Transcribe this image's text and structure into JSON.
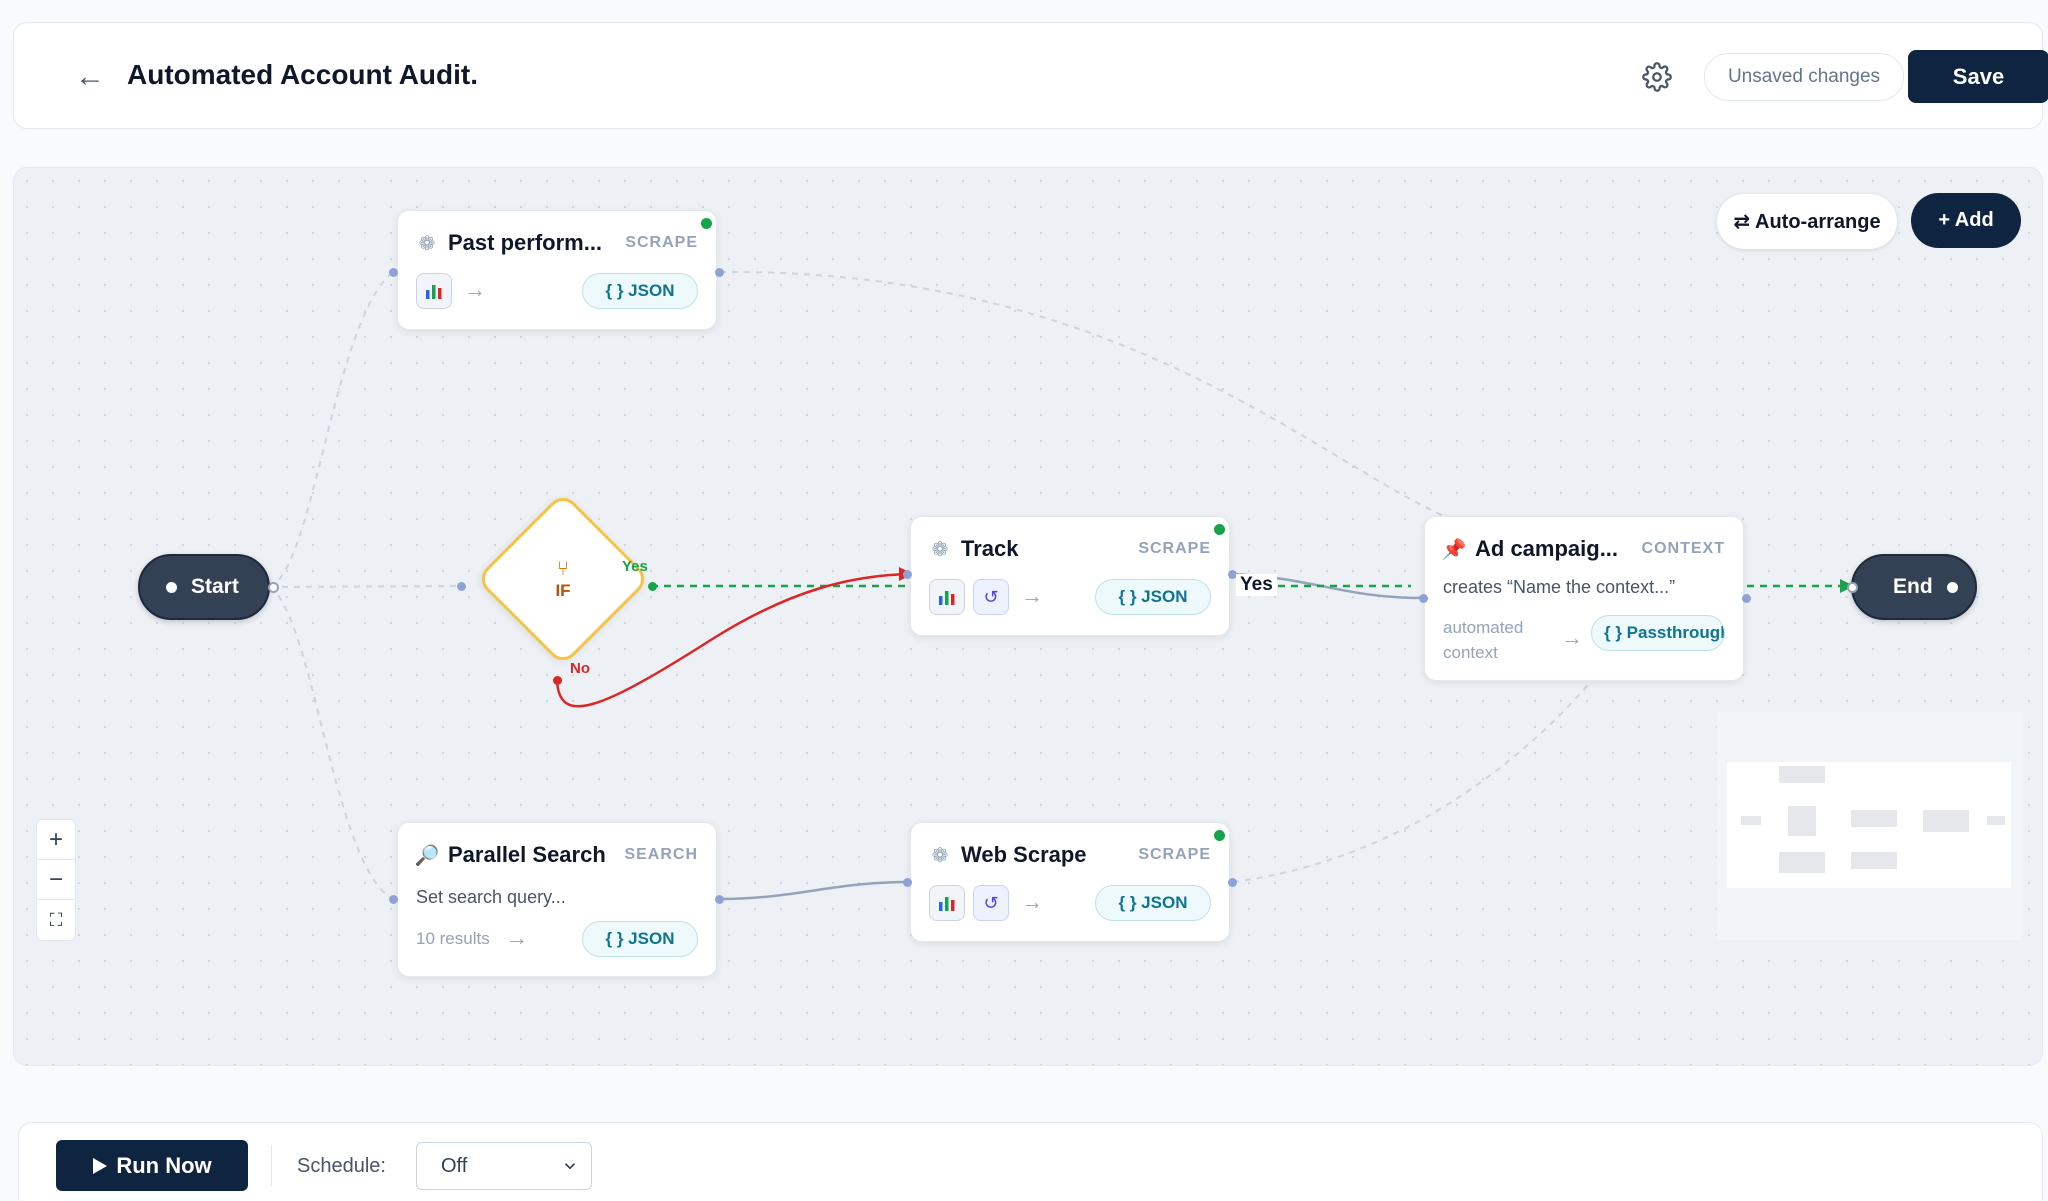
{
  "header": {
    "back_icon": "←",
    "title": "Automated Account Audit.",
    "settings_icon": "gear-icon",
    "unsaved": "Unsaved changes",
    "save_label": "Save"
  },
  "canvas": {
    "auto_arrange_label": "⇄ Auto-arrange",
    "add_label": "+ Add",
    "start_label": "Start",
    "end_label": "End",
    "if_node": {
      "label": "IF",
      "yes": "Yes",
      "no": "No"
    },
    "edge_label_yes": "Yes",
    "nodes": {
      "past_performance": {
        "title": "Past perform...",
        "type": "SCRAPE",
        "output": "{ } JSON"
      },
      "track": {
        "title": "Track",
        "type": "SCRAPE",
        "output": "{ } JSON"
      },
      "ad_campaign": {
        "title": "Ad campaig...",
        "type": "CONTEXT",
        "description": "creates “Name the context...”",
        "input_label": "automated context",
        "output": "{ } Passthrough"
      },
      "parallel_search": {
        "title": "Parallel Search",
        "type": "SEARCH",
        "placeholder": "Set search query...",
        "results": "10 results",
        "output": "{ } JSON"
      },
      "web_scrape": {
        "title": "Web Scrape",
        "type": "SCRAPE",
        "output": "{ } JSON"
      }
    },
    "zoom": {
      "in": "+",
      "out": "−",
      "fit": "⛶"
    }
  },
  "bottom": {
    "run_label": "Run Now",
    "schedule_label": "Schedule:",
    "schedule_value": "Off"
  },
  "colors": {
    "primary": "#0f2440",
    "success": "#16a34a",
    "danger": "#dc2626",
    "warning": "#f6c343",
    "accent": "#0e7490"
  }
}
